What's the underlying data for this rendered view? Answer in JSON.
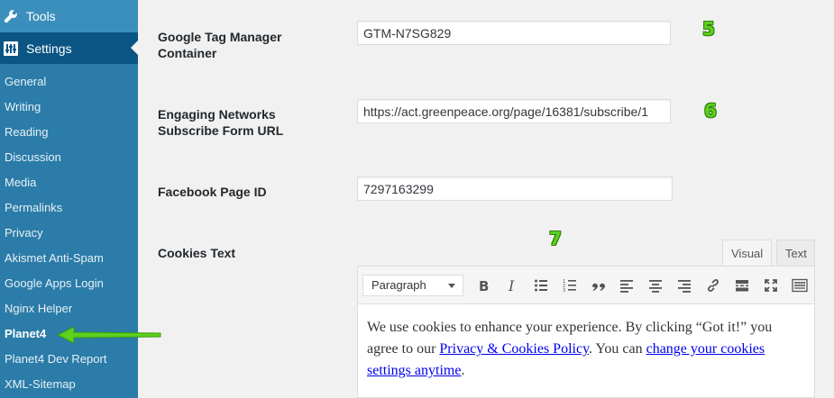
{
  "sidebar": {
    "tools_label": "Tools",
    "settings_label": "Settings",
    "items": [
      {
        "label": "General"
      },
      {
        "label": "Writing"
      },
      {
        "label": "Reading"
      },
      {
        "label": "Discussion"
      },
      {
        "label": "Media"
      },
      {
        "label": "Permalinks"
      },
      {
        "label": "Privacy"
      },
      {
        "label": "Akismet Anti-Spam"
      },
      {
        "label": "Google Apps Login"
      },
      {
        "label": "Nginx Helper"
      },
      {
        "label": "Planet4"
      },
      {
        "label": "Planet4 Dev Report"
      },
      {
        "label": "XML-Sitemap"
      }
    ]
  },
  "fields": {
    "gtm": {
      "label": "Google Tag Manager Container",
      "value": "GTM-N7SG829",
      "badge": "5"
    },
    "en": {
      "label": "Engaging Networks Subscribe Form URL",
      "value": "https://act.greenpeace.org/page/16381/subscribe/1",
      "badge": "6"
    },
    "fb": {
      "label": "Facebook Page ID",
      "value": "7297163299"
    },
    "cookies": {
      "label": "Cookies Text",
      "badge": "7"
    }
  },
  "editor": {
    "tab_visual": "Visual",
    "tab_text": "Text",
    "format_select": "Paragraph",
    "toolbar_icons": [
      "bold-icon",
      "italic-icon",
      "bullet-list-icon",
      "numbered-list-icon",
      "blockquote-icon",
      "align-left-icon",
      "align-center-icon",
      "align-right-icon",
      "link-icon",
      "read-more-icon",
      "fullscreen-icon",
      "toolbar-toggle-icon"
    ],
    "content": {
      "text1": "We use cookies to enhance your experience. By clicking “Got it!” you agree to our ",
      "link1": "Privacy & Cookies Policy",
      "text2": ". You can ",
      "link2": "change your cookies settings anytime",
      "text3": "."
    }
  },
  "colors": {
    "sidebar_bg": "#2b7ca8",
    "settings_active_bg": "#0b5584",
    "badge_green": "#5cd11e",
    "pointer_arrow": "#5cd11e"
  }
}
